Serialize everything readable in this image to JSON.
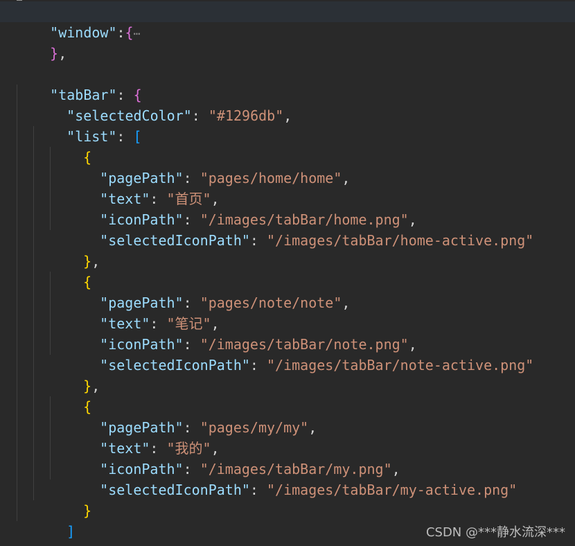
{
  "code": {
    "window_key": "\"window\"",
    "fold_ellipsis": "⋯",
    "tabbar_key": "\"tabBar\"",
    "selected_color_key": "\"selectedColor\"",
    "selected_color_value": "\"#1296db\"",
    "list_key": "\"list\"",
    "page_path_key": "\"pagePath\"",
    "text_key": "\"text\"",
    "icon_path_key": "\"iconPath\"",
    "selected_icon_path_key": "\"selectedIconPath\"",
    "items": [
      {
        "page_path": "\"pages/home/home\"",
        "text": "\"首页\"",
        "icon_path": "\"/images/tabBar/home.png\"",
        "selected_icon_path": "\"/images/tabBar/home-active.png\""
      },
      {
        "page_path": "\"pages/note/note\"",
        "text": "\"笔记\"",
        "icon_path": "\"/images/tabBar/note.png\"",
        "selected_icon_path": "\"/images/tabBar/note-active.png\""
      },
      {
        "page_path": "\"pages/my/my\"",
        "text": "\"我的\"",
        "icon_path": "\"/images/tabBar/my.png\"",
        "selected_icon_path": "\"/images/tabBar/my-active.png\""
      }
    ]
  },
  "watermark": "CSDN @***静水流深***",
  "colors": {
    "background": "#292929",
    "key": "#9cdcfe",
    "string": "#ce9178",
    "bracket_level1": "#ffd700",
    "bracket_level2": "#da70d6",
    "bracket_level3": "#179fff"
  }
}
